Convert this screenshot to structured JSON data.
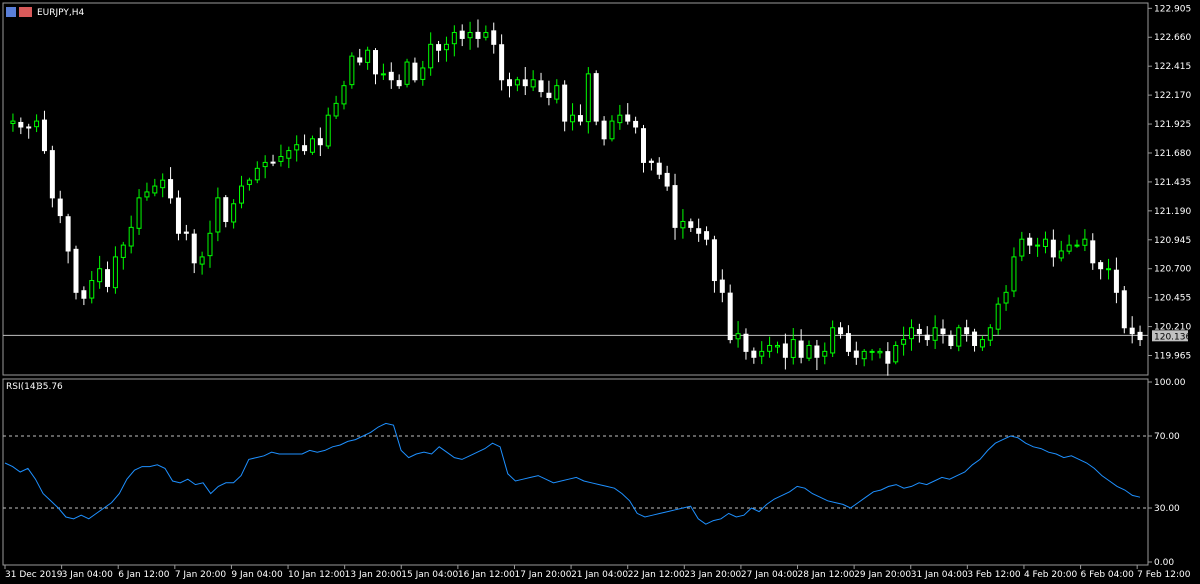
{
  "chart_data": [
    {
      "type": "candlestick",
      "title": "EURJPY,H4",
      "current_price": "120.136",
      "price_line": 120.136,
      "ylim": [
        119.8,
        122.95
      ],
      "yticks": [
        "122.905",
        "122.660",
        "122.415",
        "122.170",
        "121.925",
        "121.680",
        "121.435",
        "121.190",
        "120.945",
        "120.700",
        "120.455",
        "120.210",
        "119.965"
      ],
      "colors": {
        "bull": "#00ff00",
        "bear": "#ffffff",
        "background": "#000000",
        "price_line": "#c0c0c0",
        "text": "#ffffff"
      },
      "close": [
        121.95,
        121.9,
        121.9,
        121.95,
        121.7,
        121.3,
        121.15,
        120.85,
        120.5,
        120.45,
        120.6,
        120.7,
        120.55,
        120.8,
        120.9,
        121.05,
        121.3,
        121.35,
        121.4,
        121.45,
        121.3,
        121.0,
        121.0,
        120.75,
        120.8,
        121.0,
        121.3,
        121.1,
        121.25,
        121.4,
        121.45,
        121.55,
        121.6,
        121.6,
        121.65,
        121.7,
        121.75,
        121.7,
        121.8,
        121.75,
        122.0,
        122.1,
        122.25,
        122.5,
        122.45,
        122.55,
        122.35,
        122.35,
        122.3,
        122.25,
        122.45,
        122.3,
        122.4,
        122.6,
        122.55,
        122.6,
        122.7,
        122.65,
        122.7,
        122.65,
        122.7,
        122.6,
        122.3,
        122.25,
        122.3,
        122.25,
        122.3,
        122.2,
        122.15,
        122.25,
        121.95,
        122.0,
        121.95,
        122.35,
        121.95,
        121.8,
        121.95,
        122.0,
        121.95,
        121.9,
        121.6,
        121.6,
        121.5,
        121.4,
        121.05,
        121.1,
        121.05,
        121.0,
        120.95,
        120.6,
        120.5,
        120.1,
        120.15,
        120.0,
        119.95,
        120.0,
        120.05,
        120.05,
        119.95,
        120.1,
        119.95,
        120.05,
        119.95,
        120.0,
        120.2,
        120.15,
        120.0,
        119.95,
        120.0,
        120.0,
        120.0,
        119.9,
        120.05,
        120.1,
        120.2,
        120.15,
        120.1,
        120.2,
        120.15,
        120.05,
        120.2,
        120.15,
        120.05,
        120.1,
        120.2,
        120.4,
        120.5,
        120.8,
        120.95,
        120.9,
        120.9,
        120.95,
        120.8,
        120.85,
        120.9,
        120.9,
        120.95,
        120.75,
        120.7,
        120.7,
        120.5,
        120.2,
        120.15,
        120.1
      ],
      "rsi": {
        "label": "RSI(14)",
        "value": "35.76",
        "period": 14,
        "ylim": [
          0,
          100
        ],
        "yticks": [
          "100.00",
          "70.00",
          "30.00",
          "0.00"
        ],
        "levels": [
          70,
          30
        ],
        "color": "#1e90ff",
        "values": [
          55,
          53,
          50,
          52,
          46,
          38,
          34,
          30,
          25,
          24,
          26,
          24,
          27,
          30,
          33,
          38,
          46,
          51,
          53,
          53,
          54,
          52,
          45,
          44,
          46,
          43,
          44,
          38,
          42,
          44,
          44,
          48,
          57,
          58,
          59,
          61,
          60,
          60,
          60,
          60,
          62,
          61,
          62,
          64,
          65,
          67,
          68,
          70,
          72,
          75,
          77,
          76,
          62,
          58,
          60,
          61,
          60,
          64,
          61,
          58,
          57,
          59,
          61,
          63,
          66,
          64,
          49,
          45,
          46,
          47,
          48,
          46,
          44,
          45,
          46,
          47,
          45,
          44,
          43,
          42,
          41,
          38,
          34,
          27,
          25,
          26,
          27,
          28,
          29,
          30,
          31,
          24,
          21,
          23,
          24,
          27,
          25,
          26,
          30,
          28,
          32,
          35,
          37,
          39,
          42,
          41,
          38,
          36,
          34,
          33,
          32,
          30,
          33,
          36,
          39,
          40,
          42,
          43,
          41,
          42,
          44,
          43,
          45,
          47,
          46,
          48,
          50,
          54,
          57,
          62,
          66,
          68,
          70,
          69,
          66,
          64,
          63,
          61,
          60,
          58,
          59,
          57,
          55,
          52,
          48,
          45,
          42,
          40,
          37,
          36
        ]
      },
      "x_tick_labels": [
        "31 Dec 2019",
        "3 Jan 04:00",
        "6 Jan 12:00",
        "7 Jan 20:00",
        "9 Jan 04:00",
        "10 Jan 12:00",
        "13 Jan 20:00",
        "15 Jan 04:00",
        "16 Jan 12:00",
        "17 Jan 20:00",
        "21 Jan 04:00",
        "22 Jan 12:00",
        "23 Jan 20:00",
        "27 Jan 04:00",
        "28 Jan 12:00",
        "29 Jan 20:00",
        "31 Jan 04:00",
        "3 Feb 12:00",
        "4 Feb 20:00",
        "6 Feb 04:00",
        "7 Feb 12:00"
      ]
    }
  ]
}
